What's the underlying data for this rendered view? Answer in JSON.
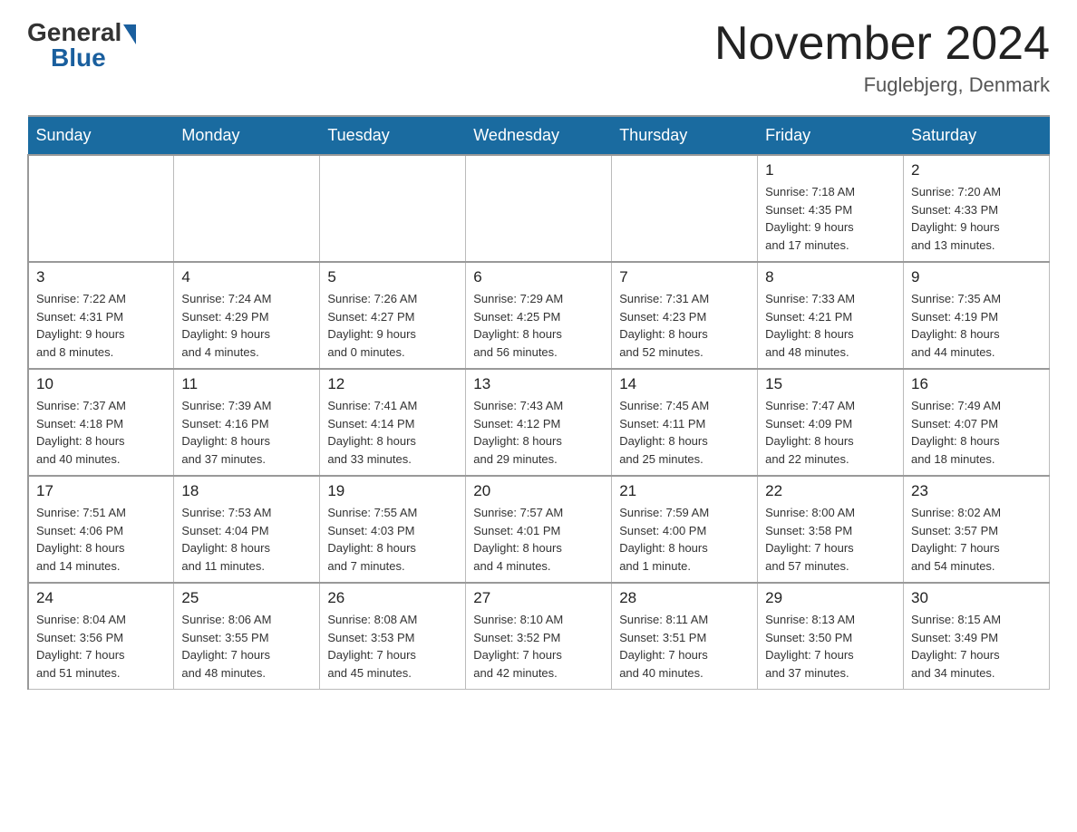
{
  "logo": {
    "general": "General",
    "blue": "Blue"
  },
  "title": "November 2024",
  "location": "Fuglebjerg, Denmark",
  "weekdays": [
    "Sunday",
    "Monday",
    "Tuesday",
    "Wednesday",
    "Thursday",
    "Friday",
    "Saturday"
  ],
  "weeks": [
    [
      {
        "day": "",
        "info": ""
      },
      {
        "day": "",
        "info": ""
      },
      {
        "day": "",
        "info": ""
      },
      {
        "day": "",
        "info": ""
      },
      {
        "day": "",
        "info": ""
      },
      {
        "day": "1",
        "info": "Sunrise: 7:18 AM\nSunset: 4:35 PM\nDaylight: 9 hours\nand 17 minutes."
      },
      {
        "day": "2",
        "info": "Sunrise: 7:20 AM\nSunset: 4:33 PM\nDaylight: 9 hours\nand 13 minutes."
      }
    ],
    [
      {
        "day": "3",
        "info": "Sunrise: 7:22 AM\nSunset: 4:31 PM\nDaylight: 9 hours\nand 8 minutes."
      },
      {
        "day": "4",
        "info": "Sunrise: 7:24 AM\nSunset: 4:29 PM\nDaylight: 9 hours\nand 4 minutes."
      },
      {
        "day": "5",
        "info": "Sunrise: 7:26 AM\nSunset: 4:27 PM\nDaylight: 9 hours\nand 0 minutes."
      },
      {
        "day": "6",
        "info": "Sunrise: 7:29 AM\nSunset: 4:25 PM\nDaylight: 8 hours\nand 56 minutes."
      },
      {
        "day": "7",
        "info": "Sunrise: 7:31 AM\nSunset: 4:23 PM\nDaylight: 8 hours\nand 52 minutes."
      },
      {
        "day": "8",
        "info": "Sunrise: 7:33 AM\nSunset: 4:21 PM\nDaylight: 8 hours\nand 48 minutes."
      },
      {
        "day": "9",
        "info": "Sunrise: 7:35 AM\nSunset: 4:19 PM\nDaylight: 8 hours\nand 44 minutes."
      }
    ],
    [
      {
        "day": "10",
        "info": "Sunrise: 7:37 AM\nSunset: 4:18 PM\nDaylight: 8 hours\nand 40 minutes."
      },
      {
        "day": "11",
        "info": "Sunrise: 7:39 AM\nSunset: 4:16 PM\nDaylight: 8 hours\nand 37 minutes."
      },
      {
        "day": "12",
        "info": "Sunrise: 7:41 AM\nSunset: 4:14 PM\nDaylight: 8 hours\nand 33 minutes."
      },
      {
        "day": "13",
        "info": "Sunrise: 7:43 AM\nSunset: 4:12 PM\nDaylight: 8 hours\nand 29 minutes."
      },
      {
        "day": "14",
        "info": "Sunrise: 7:45 AM\nSunset: 4:11 PM\nDaylight: 8 hours\nand 25 minutes."
      },
      {
        "day": "15",
        "info": "Sunrise: 7:47 AM\nSunset: 4:09 PM\nDaylight: 8 hours\nand 22 minutes."
      },
      {
        "day": "16",
        "info": "Sunrise: 7:49 AM\nSunset: 4:07 PM\nDaylight: 8 hours\nand 18 minutes."
      }
    ],
    [
      {
        "day": "17",
        "info": "Sunrise: 7:51 AM\nSunset: 4:06 PM\nDaylight: 8 hours\nand 14 minutes."
      },
      {
        "day": "18",
        "info": "Sunrise: 7:53 AM\nSunset: 4:04 PM\nDaylight: 8 hours\nand 11 minutes."
      },
      {
        "day": "19",
        "info": "Sunrise: 7:55 AM\nSunset: 4:03 PM\nDaylight: 8 hours\nand 7 minutes."
      },
      {
        "day": "20",
        "info": "Sunrise: 7:57 AM\nSunset: 4:01 PM\nDaylight: 8 hours\nand 4 minutes."
      },
      {
        "day": "21",
        "info": "Sunrise: 7:59 AM\nSunset: 4:00 PM\nDaylight: 8 hours\nand 1 minute."
      },
      {
        "day": "22",
        "info": "Sunrise: 8:00 AM\nSunset: 3:58 PM\nDaylight: 7 hours\nand 57 minutes."
      },
      {
        "day": "23",
        "info": "Sunrise: 8:02 AM\nSunset: 3:57 PM\nDaylight: 7 hours\nand 54 minutes."
      }
    ],
    [
      {
        "day": "24",
        "info": "Sunrise: 8:04 AM\nSunset: 3:56 PM\nDaylight: 7 hours\nand 51 minutes."
      },
      {
        "day": "25",
        "info": "Sunrise: 8:06 AM\nSunset: 3:55 PM\nDaylight: 7 hours\nand 48 minutes."
      },
      {
        "day": "26",
        "info": "Sunrise: 8:08 AM\nSunset: 3:53 PM\nDaylight: 7 hours\nand 45 minutes."
      },
      {
        "day": "27",
        "info": "Sunrise: 8:10 AM\nSunset: 3:52 PM\nDaylight: 7 hours\nand 42 minutes."
      },
      {
        "day": "28",
        "info": "Sunrise: 8:11 AM\nSunset: 3:51 PM\nDaylight: 7 hours\nand 40 minutes."
      },
      {
        "day": "29",
        "info": "Sunrise: 8:13 AM\nSunset: 3:50 PM\nDaylight: 7 hours\nand 37 minutes."
      },
      {
        "day": "30",
        "info": "Sunrise: 8:15 AM\nSunset: 3:49 PM\nDaylight: 7 hours\nand 34 minutes."
      }
    ]
  ]
}
